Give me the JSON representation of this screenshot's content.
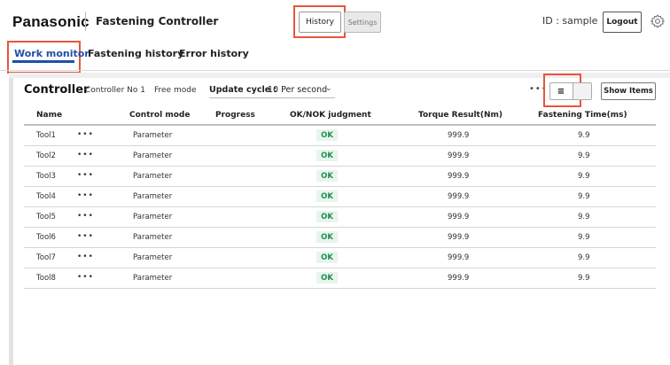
{
  "header": {
    "brand": "Panasonic",
    "app_title": "Fastening Controller",
    "history_label": "History",
    "settings_label": "Settings",
    "user_id": "ID : sample",
    "logout_label": "Logout",
    "settings_icon": "gear-icon"
  },
  "tabs": [
    {
      "label": "Work monitor",
      "active": true
    },
    {
      "label": "Fastening history",
      "active": false
    },
    {
      "label": "Error history",
      "active": false
    }
  ],
  "controller": {
    "title": "Controller",
    "name": "Controller No 1",
    "mode": "Free mode",
    "update_cycle_label": "Update cycle :",
    "update_cycle_value": "10 Per second",
    "update_cycle_chevron": "chevron-down-icon",
    "more": "•••",
    "list_view_icon": "list-view-icon",
    "show_items_label": "Show Items"
  },
  "table": {
    "columns": [
      "Name",
      "Control mode",
      "Progress",
      "OK/NOK judgment",
      "Torque Result(Nm)",
      "Fastening Time(ms)"
    ],
    "rows": [
      {
        "name": "Tool1",
        "more": "•••",
        "mode": "Parameter",
        "judgment": "OK",
        "torque": "999.9",
        "time": "9.9"
      },
      {
        "name": "Tool2",
        "more": "•••",
        "mode": "Parameter",
        "judgment": "OK",
        "torque": "999.9",
        "time": "9.9"
      },
      {
        "name": "Tool3",
        "more": "•••",
        "mode": "Parameter",
        "judgment": "OK",
        "torque": "999.9",
        "time": "9.9"
      },
      {
        "name": "Tool4",
        "more": "•••",
        "mode": "Parameter",
        "judgment": "OK",
        "torque": "999.9",
        "time": "9.9"
      },
      {
        "name": "Tool5",
        "more": "•••",
        "mode": "Parameter",
        "judgment": "OK",
        "torque": "999.9",
        "time": "9.9"
      },
      {
        "name": "Tool6",
        "more": "•••",
        "mode": "Parameter",
        "judgment": "OK",
        "torque": "999.9",
        "time": "9.9"
      },
      {
        "name": "Tool7",
        "more": "•••",
        "mode": "Parameter",
        "judgment": "OK",
        "torque": "999.9",
        "time": "9.9"
      },
      {
        "name": "Tool8",
        "more": "•••",
        "mode": "Parameter",
        "judgment": "OK",
        "torque": "999.9",
        "time": "9.9"
      }
    ]
  },
  "colors": {
    "accent": "#1f4fa8",
    "highlight": "#e8553c",
    "ok_text": "#1f8d4e",
    "ok_bg": "#e7f5ee"
  }
}
